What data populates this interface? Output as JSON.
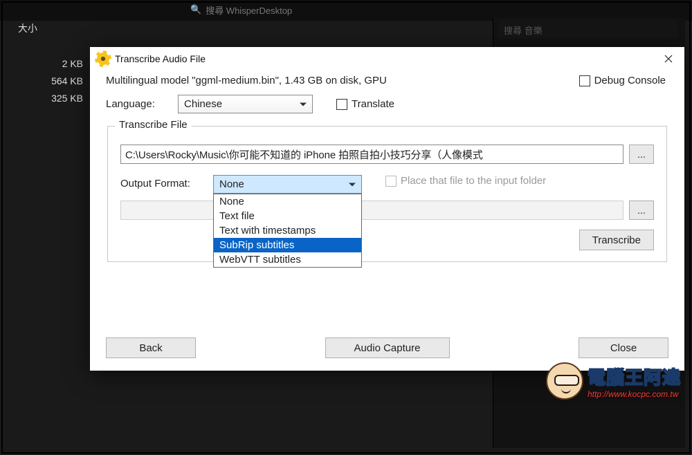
{
  "background": {
    "search_placeholder_top": "搜尋 WhisperDesktop",
    "search_placeholder_right": "搜尋 音樂",
    "column_header": "大小",
    "file_sizes": [
      "2 KB",
      "564 KB",
      "325 KB"
    ]
  },
  "dialog": {
    "title": "Transcribe Audio File",
    "model_info": "Multilingual model \"ggml-medium.bin\", 1.43 GB on disk, GPU",
    "debug_console_label": "Debug Console",
    "language_label": "Language:",
    "language_value": "Chinese",
    "translate_label": "Translate",
    "group_title": "Transcribe File",
    "file_path": "C:\\Users\\Rocky\\Music\\你可能不知道的 iPhone 拍照自拍小技巧分享（人像模式",
    "browse_button": "...",
    "output_format_label": "Output Format:",
    "output_format_value": "None",
    "output_format_options": [
      "None",
      "Text file",
      "Text with timestamps",
      "SubRip subtitles",
      "WebVTT subtitles"
    ],
    "output_format_highlighted_index": 3,
    "place_to_input_label": "Place that file to the input folder",
    "output_browse_button": "...",
    "transcribe_button": "Transcribe",
    "back_button": "Back",
    "audio_capture_button": "Audio Capture",
    "close_button": "Close"
  },
  "watermark": {
    "title": "電腦王阿達",
    "url": "http://www.kocpc.com.tw"
  }
}
